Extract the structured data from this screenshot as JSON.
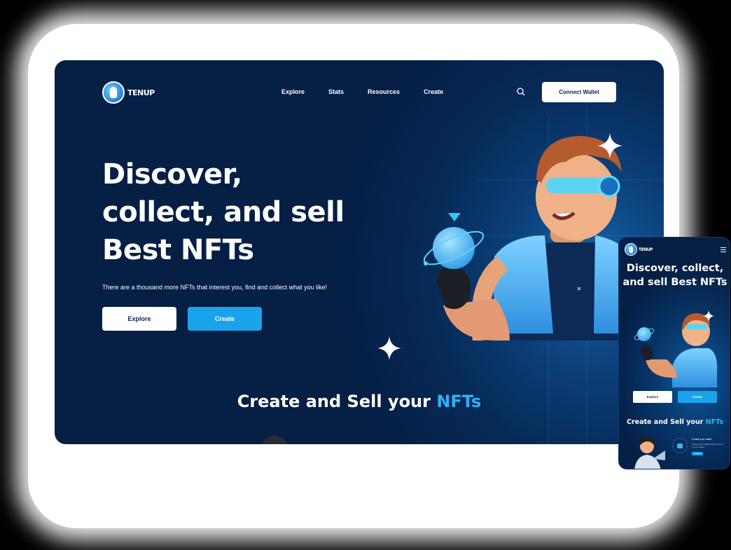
{
  "desktop": {
    "logo": {
      "text": "TENUP",
      "icon": "hand-pointer-icon"
    },
    "nav": {
      "links": [
        "Explore",
        "Stats",
        "Resources",
        "Create"
      ],
      "search_icon": "search-icon",
      "connect_label": "Connect Wallet"
    },
    "hero": {
      "title": "Discover, collect, and sell Best NFTs",
      "subtitle": "There are a thousand more NFTs that interest you, find and collect what you like!",
      "explore_label": "Explore",
      "create_label": "Create"
    },
    "section": {
      "title_prefix": "Create and Sell your ",
      "title_accent": "NFTs"
    }
  },
  "mobile": {
    "logo_text": "TENUP",
    "menu_icon": "hamburger-menu-icon",
    "hero_title": "Discover, collect, and sell Best NFTs",
    "explore_label": "Explore",
    "create_label": "Create",
    "section": {
      "title_prefix": "Create and Sell your ",
      "title_accent": "NFTs"
    },
    "step": {
      "title": "Create your wallet",
      "desc": "Choose your wallet and connect it to your wallet",
      "link": "Create"
    }
  },
  "colors": {
    "background_dark": "#06244c",
    "accent_blue": "#1aa3ea",
    "accent_text": "#2cb2f5",
    "white": "#ffffff"
  }
}
